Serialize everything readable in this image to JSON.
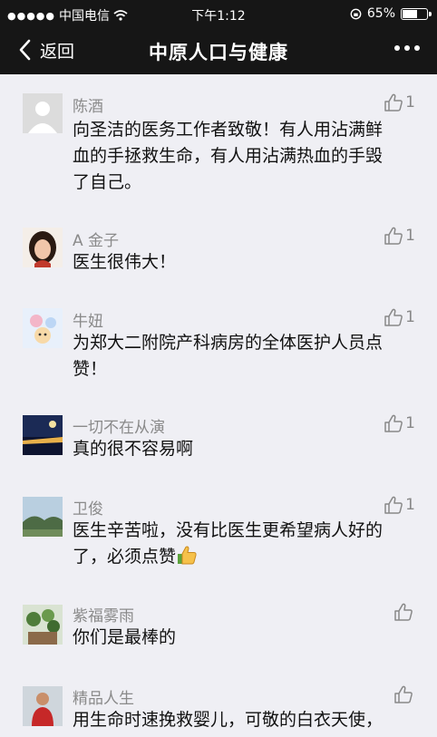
{
  "status_bar": {
    "carrier": "中国电信",
    "time": "下午1:12",
    "battery": "65%",
    "battery_level": 0.65
  },
  "nav": {
    "back_label": "返回",
    "title": "中原人口与健康"
  },
  "comments": [
    {
      "name": "陈酒",
      "lines": [
        "向圣洁的医务工作者致敬！有人用沾满鲜",
        "血的手拯救生命，有人用沾满热血的手毁",
        "了自己。"
      ],
      "likes": "1"
    },
    {
      "name": "A 金子",
      "lines": [
        "医生很伟大！"
      ],
      "likes": "1"
    },
    {
      "name": "牛妞",
      "lines": [
        "为郑大二附院产科病房的全体医护人员点",
        "赞！"
      ],
      "likes": "1"
    },
    {
      "name": "一切不在从演",
      "lines": [
        "真的很不容易啊"
      ],
      "likes": "1"
    },
    {
      "name": "卫俊",
      "lines": [
        "医生辛苦啦，没有比医生更希望病人好的",
        "了，必须点赞"
      ],
      "likes": "1"
    },
    {
      "name": "紫福雾雨",
      "lines": [
        "你们是最棒的"
      ],
      "likes": ""
    },
    {
      "name": "精品人生",
      "lines": [
        "用生命时速挽救婴儿，可敬的白衣天使，"
      ],
      "likes": ""
    }
  ],
  "icons": {
    "back": "chevron-left-icon",
    "more": "more-dots-icon",
    "like": "thumbs-up-icon",
    "wifi": "wifi-icon",
    "battery": "battery-icon"
  },
  "colors": {
    "topbar": "#161616",
    "background": "#efeff4",
    "name": "#8a8a8a",
    "like": "#888888"
  }
}
